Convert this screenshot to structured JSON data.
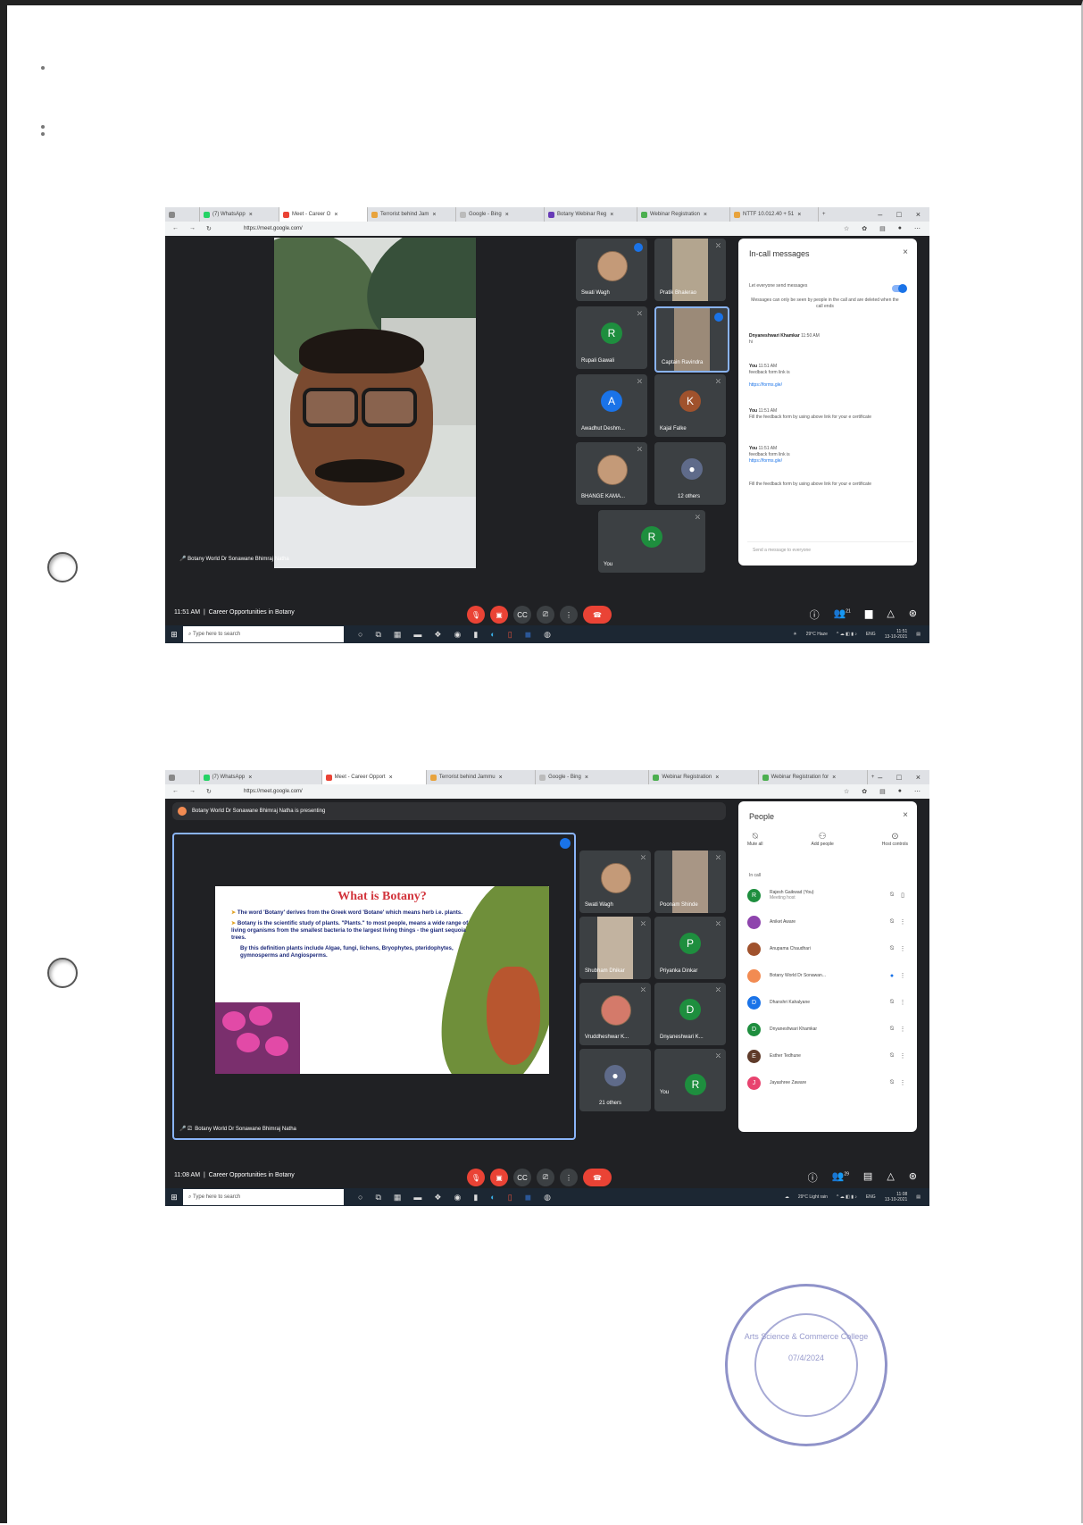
{
  "screen1": {
    "tabs": [
      "(7) WhatsApp",
      "Meet - Career O",
      "Terrorist behind Jam",
      "Google - Bing",
      "Botany Webinar Reg",
      "Webinar Registration",
      "NTTF 10.012.40 + 51"
    ],
    "url": "https://meet.google.com/",
    "speaker_name": "Botany World Dr Sonawane Bhimraj Natha",
    "tiles": [
      {
        "name": "Swati Wagh",
        "initial": ""
      },
      {
        "name": "Pratik Bhalerao",
        "initial": ""
      },
      {
        "name": "Rupali Gawali",
        "initial": "R",
        "color": "#1e8e3e"
      },
      {
        "name": "Captain Ravindra",
        "initial": ""
      },
      {
        "name": "Awadhut Deshm...",
        "initial": "A",
        "color": "#1a73e8"
      },
      {
        "name": "Kajal Falke",
        "initial": "K",
        "color": "#a0522d"
      },
      {
        "name": "BHANGE KAMA...",
        "initial": ""
      },
      {
        "name": "12 others",
        "initial": ""
      },
      {
        "name": "You",
        "initial": "R",
        "color": "#1e8e3e"
      }
    ],
    "panel": {
      "title": "In-call messages",
      "allow_label": "Let everyone send messages",
      "notice": "Messages can only be seen by people in the call and are deleted when the call ends",
      "messages": [
        {
          "sender": "Dnyaneshwari Khamkar",
          "time": "11:50 AM",
          "text": "hi"
        },
        {
          "sender": "You",
          "time": "11:51 AM",
          "text": "feedback form link is",
          "link": "https://forms.gle/"
        },
        {
          "sender": "You",
          "time": "11:51 AM",
          "text": "Fill the feedback form by using above link for your e certificate"
        },
        {
          "sender": "You",
          "time": "11:51 AM",
          "text": "feedback form link is",
          "link": "https://forms.gle/"
        },
        {
          "sender": "",
          "time": "",
          "text": "Fill the feedback form by using above link for your e certificate"
        }
      ],
      "send_placeholder": "Send a message to everyone"
    },
    "meeting_time": "11:51 AM",
    "meeting_title": "Career Opportunities in Botany",
    "participant_count": "21",
    "taskbar": {
      "search": "Type here to search",
      "weather": "29°C Haze",
      "lang": "ENG",
      "time": "11:51",
      "date": "13-10-2021"
    }
  },
  "screen2": {
    "tabs": [
      "(7) WhatsApp",
      "Meet - Career Opport",
      "Terrorist behind Jammu",
      "Google - Bing",
      "Webinar Registration",
      "Webinar Registration for"
    ],
    "url": "https://meet.google.com/",
    "presenting_banner": "Botany World Dr Sonawane Bhimraj Natha is presenting",
    "presenter_name": "Botany World Dr Sonawane Bhimraj Natha",
    "slide": {
      "title": "What is Botany?",
      "bullet1": "The word 'Botany' derives from the Greek word 'Botane' which means herb i.e. plants.",
      "bullet2": "Botany is the scientific study of plants. \"Plants.\" to most people, means a wide range of living organisms from the smallest bacteria to the largest living things - the giant sequoia trees.",
      "para": "By this definition plants include Algae, fungi, lichens, Bryophytes, pteridophytes, gymnosperms and Angiosperms."
    },
    "tiles": [
      {
        "name": "Swati Wagh",
        "initial": ""
      },
      {
        "name": "Poonam Shinde",
        "initial": ""
      },
      {
        "name": "Shubham Dhikar",
        "initial": ""
      },
      {
        "name": "Priyanka Dinkar",
        "initial": "P",
        "color": "#1e8e3e"
      },
      {
        "name": "Vruddheshwar K...",
        "initial": ""
      },
      {
        "name": "Dnyaneshwari K...",
        "initial": "D",
        "color": "#1e8e3e"
      },
      {
        "name": "21 others",
        "initial": ""
      },
      {
        "name": "You",
        "initial": "R",
        "color": "#1e8e3e"
      }
    ],
    "panel": {
      "title": "People",
      "actions": [
        "Mute all",
        "Add people",
        "Host controls"
      ],
      "section": "In call",
      "people": [
        {
          "name": "Rajesh Gaikwad (You)",
          "sub": "Meeting host",
          "initial": "R",
          "color": "#1e8e3e"
        },
        {
          "name": "Aniket Aware",
          "initial": "",
          "color": "#8e44ad"
        },
        {
          "name": "Anupama Chaudhari",
          "initial": "",
          "color": "#a0522d"
        },
        {
          "name": "Botany World Dr Sonawan...",
          "initial": "",
          "color": "#f28b52"
        },
        {
          "name": "Dhanshri Kahalyane",
          "initial": "D",
          "color": "#1a73e8"
        },
        {
          "name": "Dnyaneshwari Khamkar",
          "initial": "D",
          "color": "#1e8e3e"
        },
        {
          "name": "Esther Tedhune",
          "initial": "E",
          "color": "#5f3b2a"
        },
        {
          "name": "Jayashree Zaware",
          "initial": "J",
          "color": "#e8436f"
        }
      ]
    },
    "meeting_time": "11:08 AM",
    "meeting_title": "Career Opportunities in Botany",
    "participant_count": "29",
    "taskbar": {
      "search": "Type here to search",
      "weather": "29°C Light rain",
      "lang": "ENG",
      "time": "11:08",
      "date": "13-10-2021"
    }
  },
  "stamp": {
    "text": "Arts Science & Commerce College",
    "date": "07/4/2024"
  }
}
